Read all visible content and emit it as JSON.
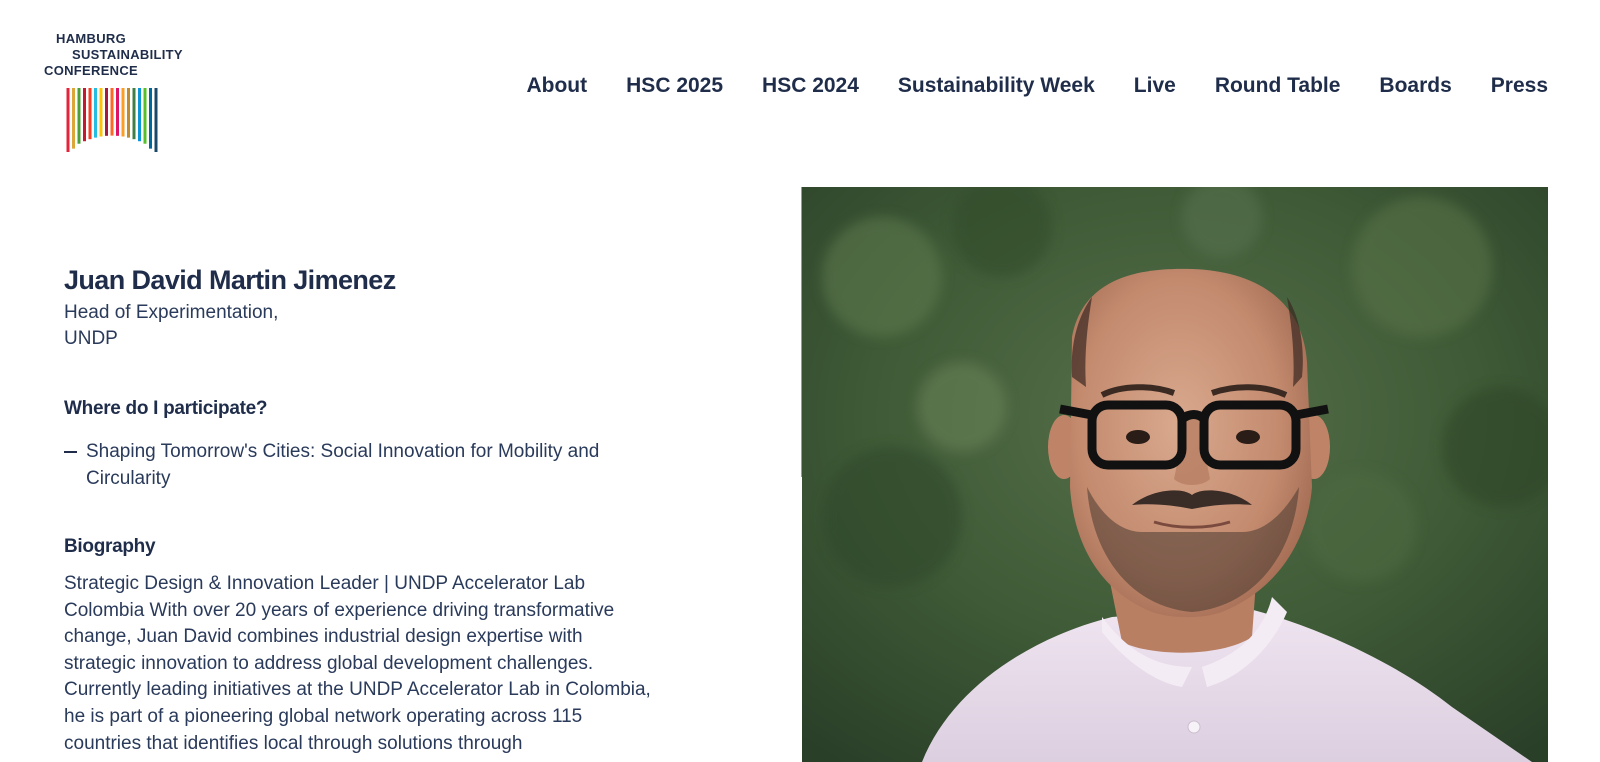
{
  "logo": {
    "line1": "HAMBURG",
    "line2": "SUSTAINABILITY",
    "line3": "CONFERENCE",
    "bar_colors": [
      "#e5243b",
      "#dda63a",
      "#4c9f38",
      "#c5192d",
      "#ff3a21",
      "#26bde2",
      "#fcc30b",
      "#a21942",
      "#fd6925",
      "#dd1367",
      "#fd9d24",
      "#bf8b2e",
      "#3f7e44",
      "#0a97d9",
      "#56c02b",
      "#00689d",
      "#19486a"
    ]
  },
  "nav": {
    "items": [
      "About",
      "HSC 2025",
      "HSC 2024",
      "Sustainability Week",
      "Live",
      "Round Table",
      "Boards",
      "Press"
    ]
  },
  "speaker": {
    "name": "Juan David Martin Jimenez",
    "role": "Head of Experimentation,",
    "organization": "UNDP"
  },
  "participation": {
    "heading": "Where do I participate?",
    "sessions": [
      "Shaping Tomorrow's Cities: Social Innovation for Mobility and Circularity"
    ]
  },
  "biography": {
    "heading": "Biography",
    "text": "Strategic Design & Innovation Leader | UNDP Accelerator Lab Colombia With over 20 years of experience driving transformative change, Juan David combines industrial design expertise with strategic innovation to address global development challenges. Currently leading initiatives at the UNDP Accelerator Lab in Colombia, he is part of a pioneering global network operating across 115 countries that identifies local through solutions through"
  },
  "colors": {
    "navy": "#1f2d4a",
    "photo_background": "#3e5a36",
    "shirt": "#ece0ee"
  }
}
